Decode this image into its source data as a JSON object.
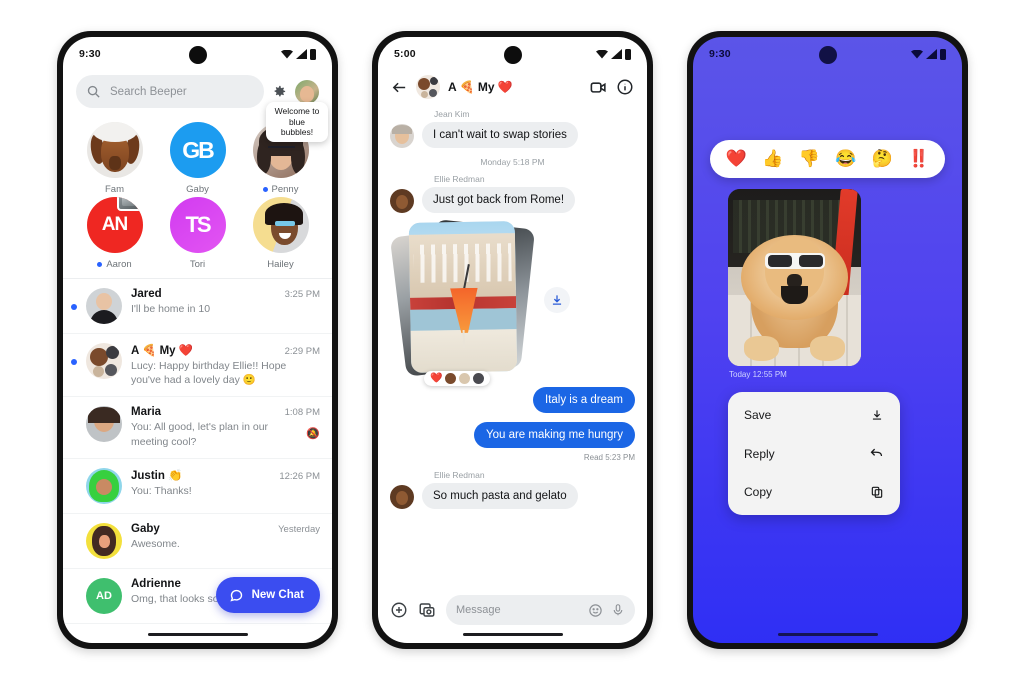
{
  "phone1": {
    "status": {
      "time": "9:30",
      "icons": [
        "wifi-icon",
        "signal-icon",
        "battery-icon"
      ]
    },
    "search": {
      "placeholder": "Search Beeper",
      "icon": "search-icon",
      "settings_icon": "gear-icon",
      "profile": "profile-avatar"
    },
    "favorites": [
      {
        "label": "Fam",
        "unread": false,
        "type": "photo-dog"
      },
      {
        "label": "Gaby",
        "unread": false,
        "type": "logo",
        "initials": "GB"
      },
      {
        "label": "Penny",
        "unread": true,
        "type": "photo-penny",
        "tooltip": "Welcome to blue bubbles!"
      },
      {
        "label": "Aaron",
        "unread": true,
        "type": "logo",
        "initials": "AN"
      },
      {
        "label": "Tori",
        "unread": false,
        "type": "logo",
        "initials": "TS"
      },
      {
        "label": "Hailey",
        "unread": false,
        "type": "photo-hailey"
      }
    ],
    "chats": [
      {
        "name": "Jared",
        "time": "3:25 PM",
        "preview": "I'll be home in 10",
        "unread": true,
        "muted": false
      },
      {
        "name": "A 🍕 My ❤️",
        "time": "2:29 PM",
        "preview": "Lucy: Happy birthday Ellie!! Hope you've had a lovely day  🙂",
        "unread": true,
        "muted": false
      },
      {
        "name": "Maria",
        "time": "1:08 PM",
        "preview": "You: All good, let's plan in our meeting cool?",
        "unread": false,
        "muted": true
      },
      {
        "name": "Justin 👏",
        "time": "12:26 PM",
        "preview": "You: Thanks!",
        "unread": false,
        "muted": false
      },
      {
        "name": "Gaby",
        "time": "Yesterday",
        "preview": "Awesome.",
        "unread": false,
        "muted": false
      },
      {
        "name": "Adrienne",
        "time": "",
        "preview": "Omg, that looks so nice!",
        "unread": false,
        "muted": false,
        "initials": "AD"
      }
    ],
    "new_chat": {
      "label": "New Chat",
      "icon": "chat-bubble-icon",
      "color": "#3b4df0"
    }
  },
  "phone2": {
    "status": {
      "time": "5:00"
    },
    "header": {
      "back_icon": "back-arrow-icon",
      "title": "A 🍕 My ❤️",
      "video_icon": "video-camera-icon",
      "info_icon": "info-icon"
    },
    "messages": [
      {
        "kind": "incoming",
        "sender": "Jean Kim",
        "text": "I can't wait to swap stories"
      },
      {
        "kind": "daystamp",
        "text": "Monday 5:18 PM"
      },
      {
        "kind": "incoming",
        "sender": "Ellie Redman",
        "text": "Just got back from Rome!"
      },
      {
        "kind": "photos",
        "reaction": "❤️",
        "download_icon": "download-icon"
      },
      {
        "kind": "outgoing",
        "text": "Italy is a dream"
      },
      {
        "kind": "outgoing",
        "text": "You are making me hungry"
      },
      {
        "kind": "receipt",
        "text": "Read  5:23 PM"
      },
      {
        "kind": "incoming",
        "sender": "Ellie Redman",
        "text": "So much pasta and gelato"
      }
    ],
    "composer": {
      "plus_icon": "plus-circle-icon",
      "gallery_icon": "photo-camera-icon",
      "placeholder": "Message",
      "emoji_icon": "emoji-icon",
      "mic_icon": "microphone-icon"
    }
  },
  "phone3": {
    "status": {
      "time": "9:30"
    },
    "reactions": [
      "❤️",
      "👍",
      "👎",
      "😂",
      "🤔",
      "‼️"
    ],
    "media": {
      "alt": "dog-photo",
      "timestamp": "Today  12:55 PM"
    },
    "menu": [
      {
        "label": "Save",
        "icon": "download-icon"
      },
      {
        "label": "Reply",
        "icon": "reply-arrow-icon"
      },
      {
        "label": "Copy",
        "icon": "copy-icon"
      }
    ],
    "background_color": "#4a3cf0"
  }
}
